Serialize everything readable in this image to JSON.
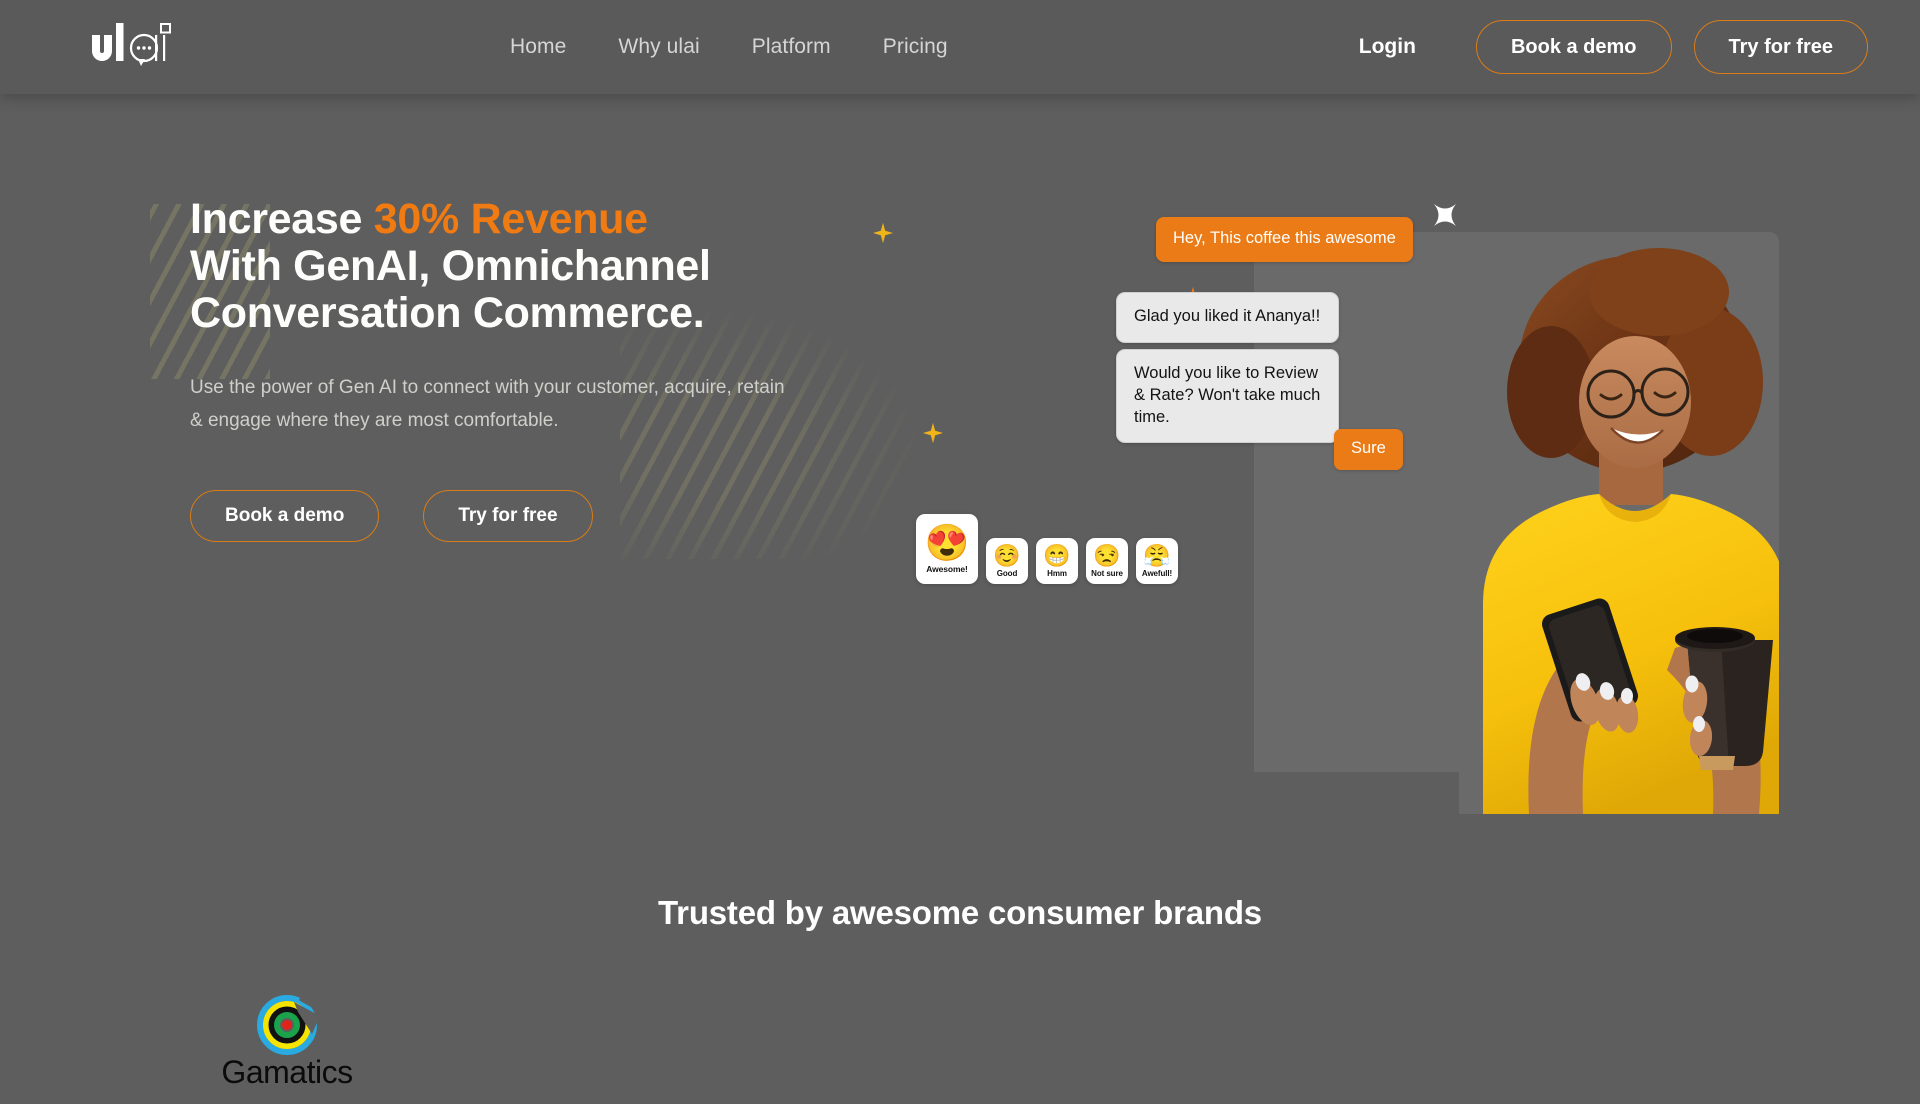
{
  "header": {
    "logo_text": "ulai",
    "logo_icon": "chat-bubble-logo-icon",
    "nav": [
      {
        "label": "Home"
      },
      {
        "label": "Why ulai"
      },
      {
        "label": "Platform"
      },
      {
        "label": "Pricing"
      }
    ],
    "login_label": "Login",
    "book_demo_label": "Book a demo",
    "try_free_label": "Try for free"
  },
  "hero": {
    "headline_line1_a": "Increase ",
    "headline_line1_accent": "30% Revenue",
    "headline_line2": "With GenAI, Omnichannel",
    "headline_line3": "Conversation Commerce.",
    "subtext": "Use the power of Gen AI to connect with your customer, acquire, retain & engage where they are most comfortable.",
    "book_demo_label": "Book a demo",
    "try_free_label": "Try for free"
  },
  "chat": {
    "close_icon": "close-icon",
    "messages": [
      {
        "from": "user",
        "text": "Hey, This coffee this awesome"
      },
      {
        "from": "bot",
        "text": "Glad you liked it Ananya!!"
      },
      {
        "from": "bot",
        "text": "Would you like to Review & Rate? Won't take much time."
      },
      {
        "from": "user",
        "text": "Sure"
      }
    ],
    "ratings": [
      {
        "label": "Awesome!",
        "glyph": "😍",
        "icon": "heart-eyes-emoji-icon",
        "selected": true
      },
      {
        "label": "Good",
        "glyph": "☺️",
        "icon": "smiling-face-emoji-icon",
        "selected": false
      },
      {
        "label": "Hmm",
        "glyph": "😁",
        "icon": "grimacing-emoji-icon",
        "selected": false
      },
      {
        "label": "Not sure",
        "glyph": "😒",
        "icon": "unamused-emoji-icon",
        "selected": false
      },
      {
        "label": "Awefull!",
        "glyph": "😤",
        "icon": "angry-steam-emoji-icon",
        "selected": false
      }
    ],
    "photo_alt": "woman-with-phone-and-coffee-photo"
  },
  "brands": {
    "title": "Trusted by awesome consumer brands",
    "items": [
      {
        "name": "Gamatics",
        "icon": "gamatics-rings-logo-icon"
      }
    ]
  },
  "colors": {
    "page_bg": "#5e5e5e",
    "header_bg": "#5a5a5a",
    "accent_orange": "#f07b13",
    "button_border": "#d97c18",
    "bubble_user": "#ea7b16",
    "bubble_bot": "#e9e9e9",
    "decor_plus_orange": "#f07b13",
    "decor_plus_yellow": "#f2b518",
    "text_primary": "#ffffff",
    "text_muted": "#cfcfcb"
  }
}
